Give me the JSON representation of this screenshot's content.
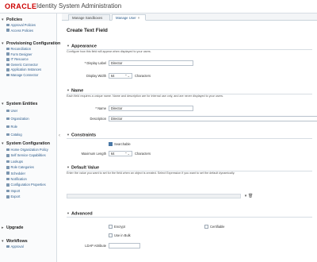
{
  "header": {
    "logo": "ORACLE",
    "title": "Identity System Administration"
  },
  "sidebar": {
    "groups": [
      {
        "title": "Policies",
        "items": [
          "Approval Policies",
          "Access Policies"
        ]
      },
      {
        "title": "Provisioning Configuration",
        "items": [
          "Reconciliation",
          "Form Designer",
          "IT Resource",
          "Generic Connector",
          "Application Instances",
          "Manage Connector"
        ]
      },
      {
        "title": "System Entities",
        "items": [
          "User",
          "Organization",
          "Role",
          "Catalog"
        ]
      },
      {
        "title": "System Configuration",
        "items": [
          "Home Organization Policy",
          "Self Service Capabilities",
          "Lookups",
          "Role Categories",
          "Scheduler",
          "Notification",
          "Configuration Properties",
          "Import",
          "Export"
        ]
      },
      {
        "title": "Upgrade",
        "items": []
      },
      {
        "title": "Workflows",
        "items": [
          "Approval"
        ]
      }
    ]
  },
  "tabs": [
    {
      "label": "Manage Sandboxes"
    },
    {
      "label": "Manage User"
    }
  ],
  "form": {
    "page_title": "Create Text Field",
    "appearance": {
      "title": "Appearance",
      "desc": "Configure how this field will appear when displayed to your users.",
      "display_label_label": "Display Label",
      "display_label_value": "Director",
      "display_width_label": "Display Width",
      "display_width_value": "64",
      "display_width_unit": "Characters"
    },
    "name": {
      "title": "Name",
      "desc": "Each field requires a unique name. Name and description are for internal use only, and are never displayed to your users.",
      "name_label": "Name",
      "name_value": "Director",
      "description_label": "Description",
      "description_value": "Director"
    },
    "constraints": {
      "title": "Constraints",
      "searchable_label": "Searchable",
      "searchable_checked": true,
      "max_length_label": "Maximum Length",
      "max_length_value": "64",
      "max_length_unit": "Characters"
    },
    "default_value": {
      "title": "Default Value",
      "desc": "Enter the value you want to set for the field when an object is created. Select Expression if you want to set the default dynamically."
    },
    "advanced": {
      "title": "Advanced",
      "encrypt_label": "Encrypt",
      "use_in_bulk_label": "Use in Bulk",
      "certifiable_label": "Certifiable",
      "ldap_attribute_label": "LDAP Attribute"
    }
  },
  "colors": {
    "brand_red": "#cc0000",
    "link_blue": "#2a5a8a",
    "checkbox_blue": "#4a78a6"
  },
  "icons": {
    "expand": "triangle-down",
    "collapse_sidebar": "chevron-left",
    "delete": "trash-icon"
  }
}
